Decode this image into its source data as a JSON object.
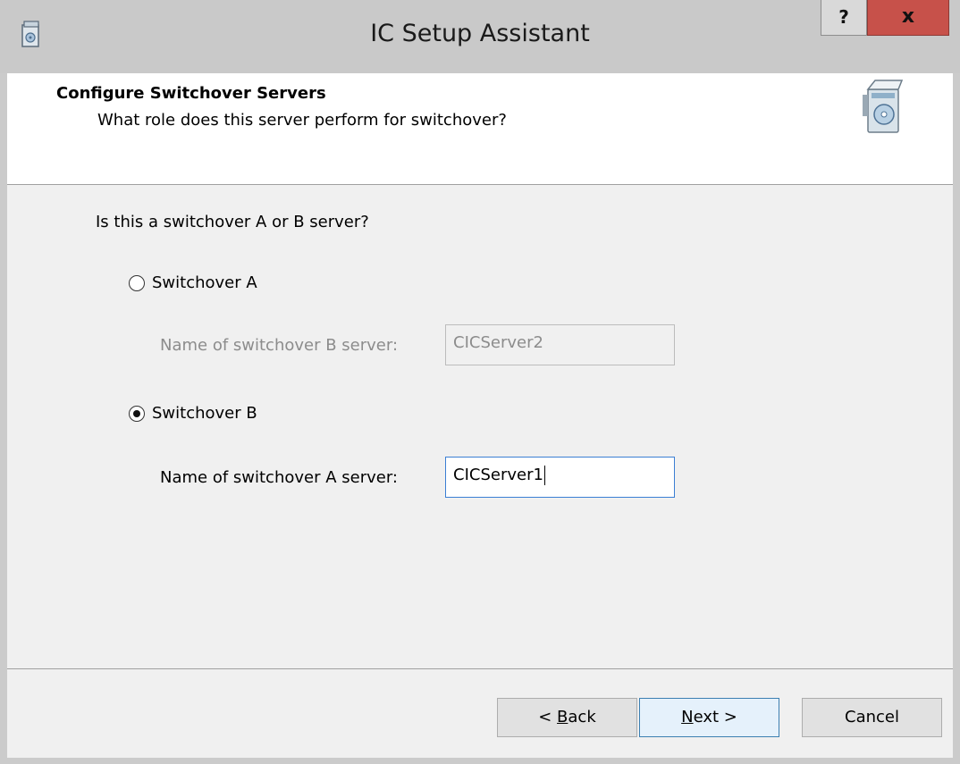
{
  "window": {
    "title": "IC Setup Assistant",
    "help_label": "?",
    "close_label": "x",
    "app_icon": "setup-app-icon"
  },
  "header": {
    "title": "Configure Switchover Servers",
    "subtitle": "What role does this server perform for switchover?",
    "icon": "setup-box-icon"
  },
  "form": {
    "question": "Is this a switchover A or B server?",
    "option_a": {
      "label": "Switchover A",
      "selected": false,
      "field_label": "Name of switchover B server:",
      "field_value": "CICServer2",
      "enabled": false
    },
    "option_b": {
      "label": "Switchover B",
      "selected": true,
      "field_label": "Name of switchover A server:",
      "field_value": "CICServer1",
      "enabled": true
    }
  },
  "buttons": {
    "back_prefix": "< ",
    "back_accel": "B",
    "back_rest": "ack",
    "next_accel": "N",
    "next_rest": "ext >",
    "cancel": "Cancel"
  },
  "colors": {
    "close_button": "#c7514a",
    "titlebar": "#c9c9c9",
    "client_bg": "#f0f0f0",
    "focus_border": "#3b7fd4"
  }
}
